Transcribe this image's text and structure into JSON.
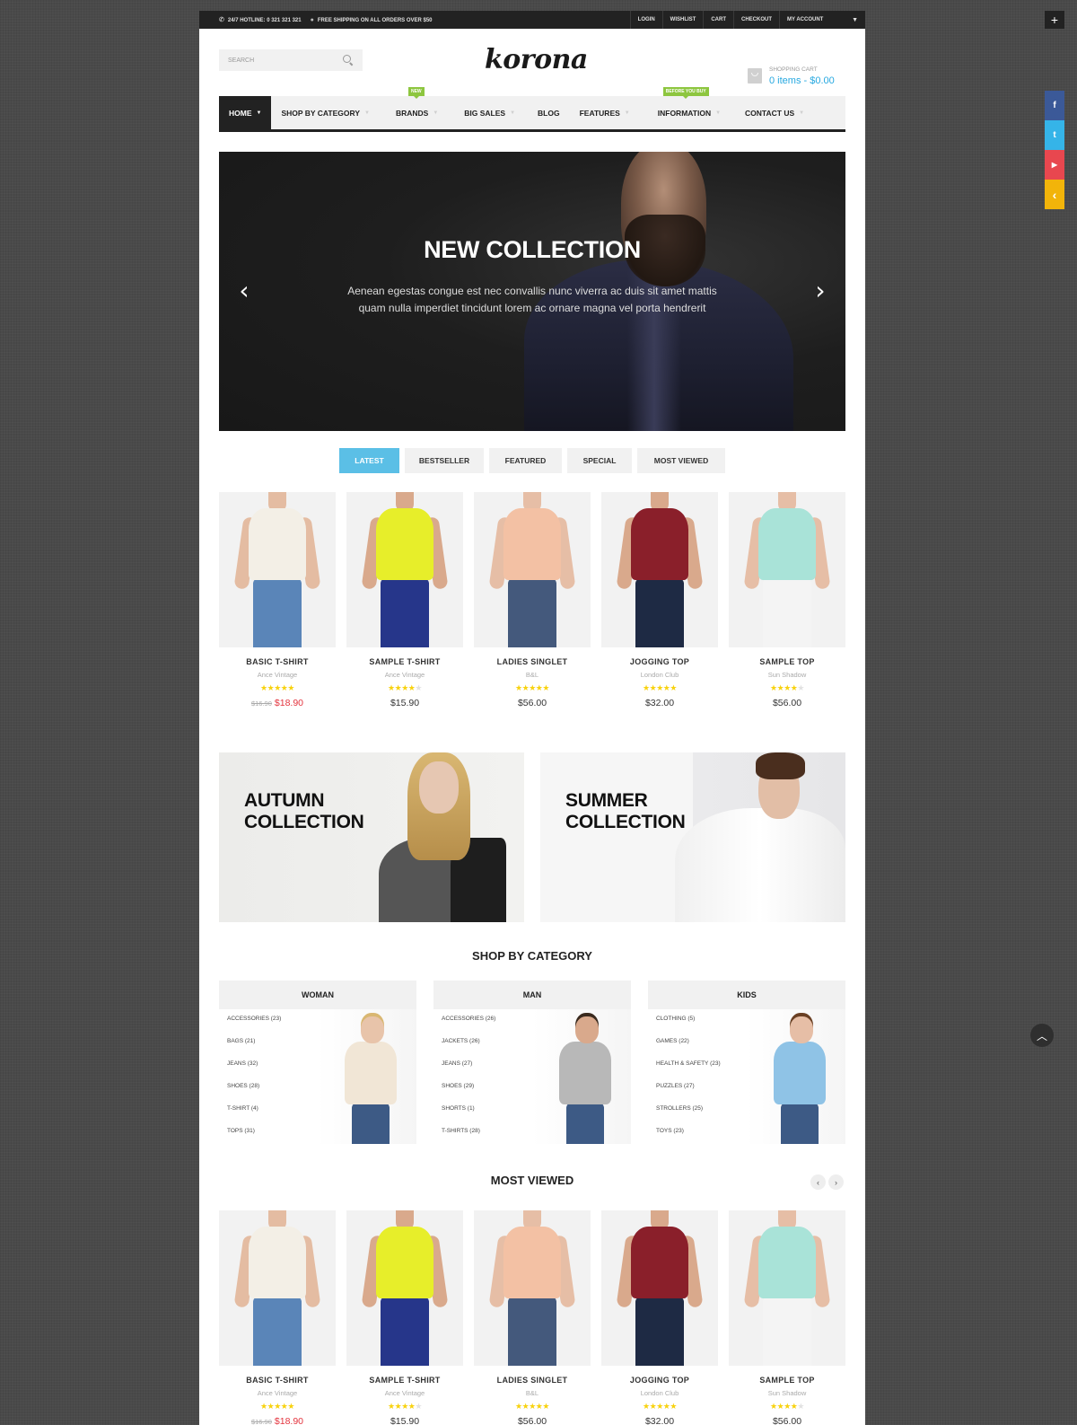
{
  "topbar": {
    "hotline": "24/7 HOTLINE: 0 321 321 321",
    "shipping": "FREE SHIPPING ON ALL ORDERS OVER $50",
    "links": [
      "LOGIN",
      "WISHLIST",
      "CART",
      "CHECKOUT"
    ],
    "account": "MY ACCOUNT",
    "icons": {
      "hotline": "phone-icon",
      "shipping": "tag-icon",
      "account": "caret-down-icon"
    }
  },
  "header": {
    "search_placeholder": "SEARCH",
    "logo": "korona",
    "cart_label": "SHOPPING CART",
    "cart_amount": "0 items - $0.00"
  },
  "nav": {
    "items": [
      {
        "label": "HOME",
        "active": true,
        "badge": null
      },
      {
        "label": "SHOP BY CATEGORY",
        "active": false,
        "badge": null
      },
      {
        "label": "BRANDS",
        "active": false,
        "badge": "NEW"
      },
      {
        "label": "BIG SALES",
        "active": false,
        "badge": null
      },
      {
        "label": "BLOG",
        "active": false,
        "badge": null
      },
      {
        "label": "FEATURES",
        "active": false,
        "badge": null
      },
      {
        "label": "INFORMATION",
        "active": false,
        "badge": "BEFORE YOU BUY"
      },
      {
        "label": "CONTACT US",
        "active": false,
        "badge": null
      }
    ],
    "badge_color": "#8dc63f"
  },
  "hero": {
    "title": "NEW COLLECTION",
    "text": "Aenean egestas congue est nec convallis nunc viverra ac duis sit amet mattis quam nulla imperdiet tincidunt lorem ac ornare magna vel porta hendrerit",
    "prev": "‹",
    "next": "›"
  },
  "tabs": [
    {
      "label": "LATEST",
      "active": true
    },
    {
      "label": "BESTSELLER",
      "active": false
    },
    {
      "label": "FEATURED",
      "active": false
    },
    {
      "label": "SPECIAL",
      "active": false
    },
    {
      "label": "MOST VIEWED",
      "active": false
    }
  ],
  "products": [
    {
      "name": "BASIC T-SHIRT",
      "brand": "Ance Vintage",
      "rating": 5,
      "old_price": "$16.90",
      "price": "$18.90",
      "special": true,
      "top": "#f3efe6",
      "bottom": "#5a85b8",
      "skin": "#e4bca2"
    },
    {
      "name": "SAMPLE T-SHIRT",
      "brand": "Ance Vintage",
      "rating": 4,
      "old_price": null,
      "price": "$15.90",
      "special": false,
      "top": "#e7ee2a",
      "bottom": "#26368a",
      "skin": "#d9a98c"
    },
    {
      "name": "LADIES SINGLET",
      "brand": "B&L",
      "rating": 5,
      "old_price": null,
      "price": "$56.00",
      "special": false,
      "top": "#f3c1a4",
      "bottom": "#44597c",
      "skin": "#e6bea6"
    },
    {
      "name": "JOGGING TOP",
      "brand": "London Club",
      "rating": 5,
      "old_price": null,
      "price": "$32.00",
      "special": false,
      "top": "#8a1f2a",
      "bottom": "#1e2a44",
      "skin": "#d9a98c"
    },
    {
      "name": "SAMPLE TOP",
      "brand": "Sun Shadow",
      "rating": 4,
      "old_price": null,
      "price": "$56.00",
      "special": false,
      "top": "#a9e3d8",
      "bottom": "#f4f4f4",
      "skin": "#e6bea6"
    }
  ],
  "banners": [
    {
      "title": "AUTUMN COLLECTION"
    },
    {
      "title": "SUMMER COLLECTION"
    }
  ],
  "shop_by_category": {
    "title": "SHOP BY CATEGORY",
    "columns": [
      {
        "name": "WOMAN",
        "items": [
          "ACCESSORIES (23)",
          "BAGS (21)",
          "JEANS (32)",
          "SHOES (28)",
          "T-SHIRT (4)",
          "TOPS (31)"
        ],
        "top": "#f1e6d6",
        "skin": "#e8c4aa",
        "hair": "#d9b772"
      },
      {
        "name": "MAN",
        "items": [
          "ACCESSORIES (26)",
          "JACKETS (26)",
          "JEANS (27)",
          "SHOES (29)",
          "SHORTS (1)",
          "T-SHIRTS (28)"
        ],
        "top": "#b8b8b8",
        "skin": "#d9a98c",
        "hair": "#3a2a1e"
      },
      {
        "name": "KIDS",
        "items": [
          "CLOTHING (5)",
          "GAMES (22)",
          "HEALTH & SAFETY (23)",
          "PUZZLES (27)",
          "STROLLERS (25)",
          "TOYS (23)"
        ],
        "top": "#8fc3e6",
        "skin": "#e6bea6",
        "hair": "#6a4024"
      }
    ]
  },
  "most_viewed": {
    "title": "MOST VIEWED",
    "prev": "‹",
    "next": "›"
  },
  "side": {
    "plus": "+",
    "social": [
      {
        "name": "facebook",
        "glyph": "f",
        "color": "#3b5998"
      },
      {
        "name": "twitter",
        "glyph": "t",
        "color": "#35b4e8"
      },
      {
        "name": "youtube",
        "glyph": "▶",
        "color": "#e8474f"
      },
      {
        "name": "toggle",
        "glyph": "‹",
        "color": "#f2b40a"
      }
    ],
    "to_top": "^"
  },
  "colors": {
    "accent": "#5bbfe6",
    "price_special": "#e3343e",
    "star": "#f8d20e",
    "cart": "#26a8e0"
  }
}
